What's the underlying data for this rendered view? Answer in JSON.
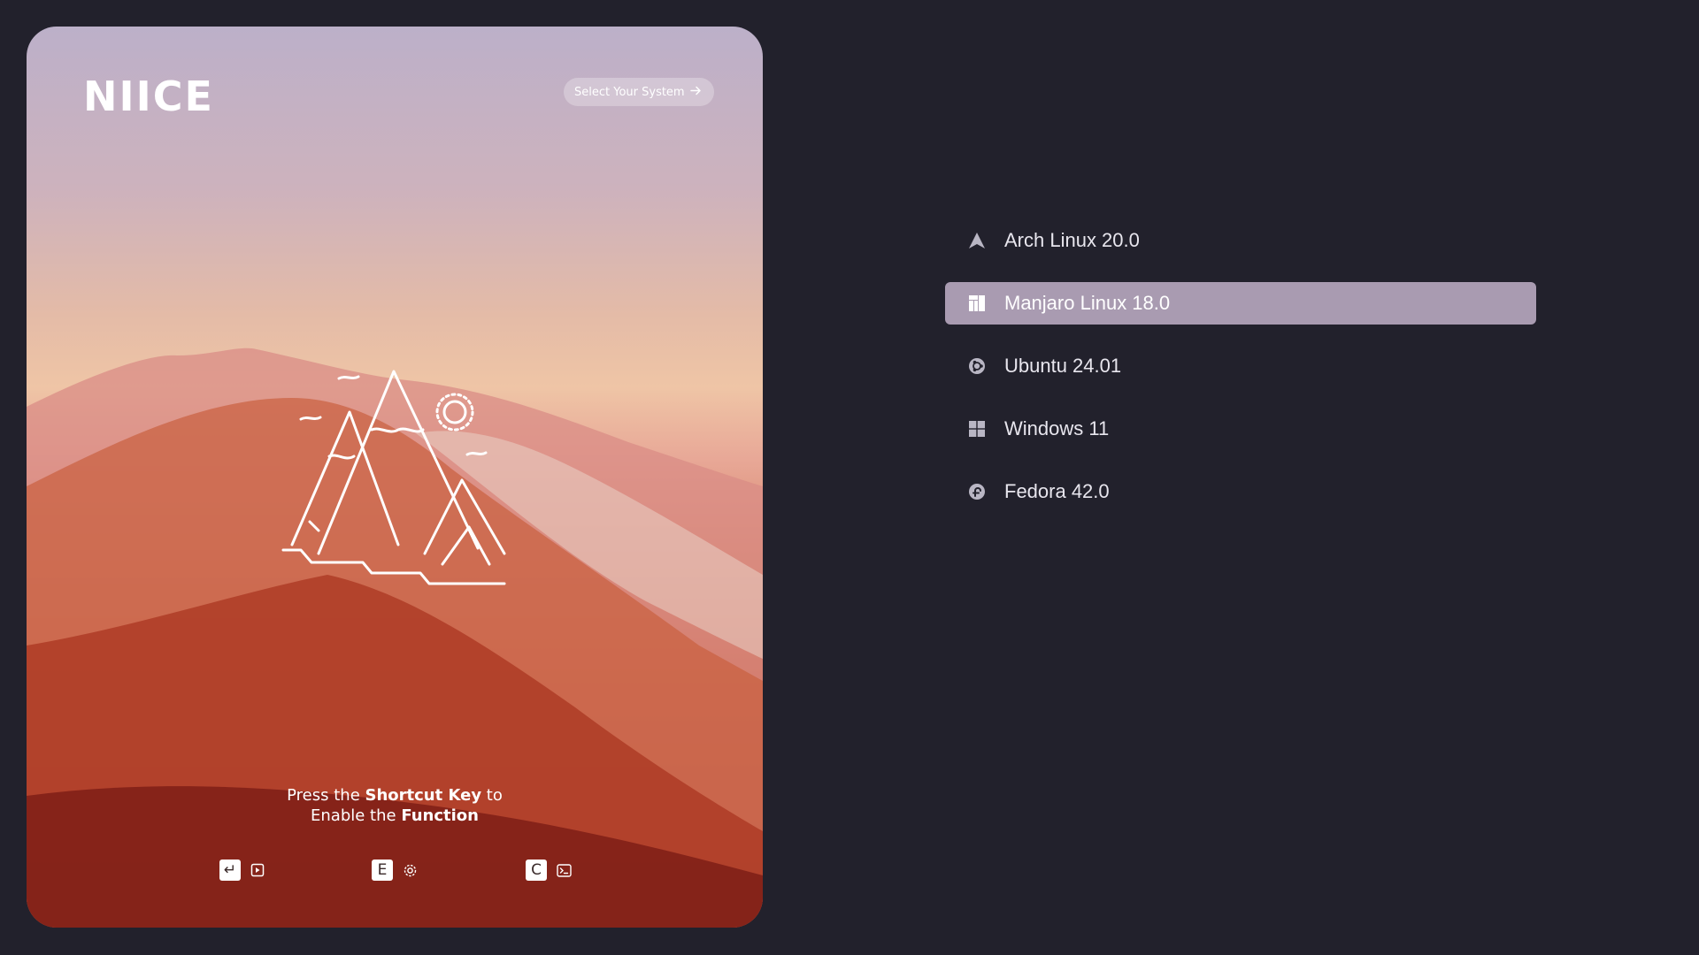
{
  "brand": {
    "logo_text": "NIICE"
  },
  "header": {
    "select_label": "Select Your System"
  },
  "hint": {
    "line1_prefix": "Press the ",
    "line1_bold": "Shortcut Key",
    "line1_suffix": " to",
    "line2_prefix": "Enable the ",
    "line2_bold": "Function"
  },
  "shortcuts": [
    {
      "key": "↵",
      "icon": "boot-icon"
    },
    {
      "key": "E",
      "icon": "gear-icon"
    },
    {
      "key": "C",
      "icon": "terminal-icon"
    }
  ],
  "os_list": [
    {
      "label": "Arch Linux 20.0",
      "icon": "arch-icon",
      "selected": false
    },
    {
      "label": "Manjaro Linux 18.0",
      "icon": "manjaro-icon",
      "selected": true
    },
    {
      "label": "Ubuntu 24.01",
      "icon": "ubuntu-icon",
      "selected": false
    },
    {
      "label": "Windows 11",
      "icon": "windows-icon",
      "selected": false
    },
    {
      "label": "Fedora 42.0",
      "icon": "fedora-icon",
      "selected": false
    }
  ],
  "colors": {
    "background": "#22212c",
    "selected_item": "#a99bb1",
    "text": "#e8e6ee"
  }
}
